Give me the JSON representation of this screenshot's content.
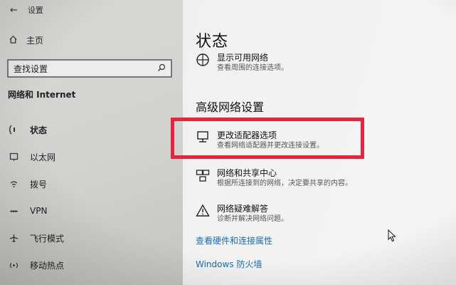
{
  "window": {
    "title": "设置"
  },
  "sidebar": {
    "home_label": "主页",
    "search_placeholder": "查找设置",
    "section_title": "网络和 Internet",
    "items": [
      {
        "label": "状态",
        "icon": "status-icon",
        "active": true
      },
      {
        "label": "以太网",
        "icon": "ethernet-icon"
      },
      {
        "label": "拨号",
        "icon": "dialup-icon"
      },
      {
        "label": "VPN",
        "icon": "vpn-icon"
      },
      {
        "label": "飞行模式",
        "icon": "airplane-icon"
      },
      {
        "label": "移动热点",
        "icon": "hotspot-icon"
      }
    ]
  },
  "main": {
    "title": "状态",
    "show_networks": {
      "title": "显示可用网络",
      "desc": "查看周围的连接选项。"
    },
    "advanced_title": "高级网络设置",
    "adapter": {
      "title": "更改适配器选项",
      "desc": "查看网络适配器并更改连接设置。"
    },
    "sharing": {
      "title": "网络和共享中心",
      "desc": "根据所连接到的网络，决定要共享的内容。"
    },
    "troubleshoot": {
      "title": "网络疑难解答",
      "desc": "诊断并解决网络问题。"
    },
    "links": [
      "查看硬件和连接属性",
      "Windows 防火墙"
    ]
  },
  "colors": {
    "highlight": "#e8233b",
    "link": "#1a6fb3"
  }
}
